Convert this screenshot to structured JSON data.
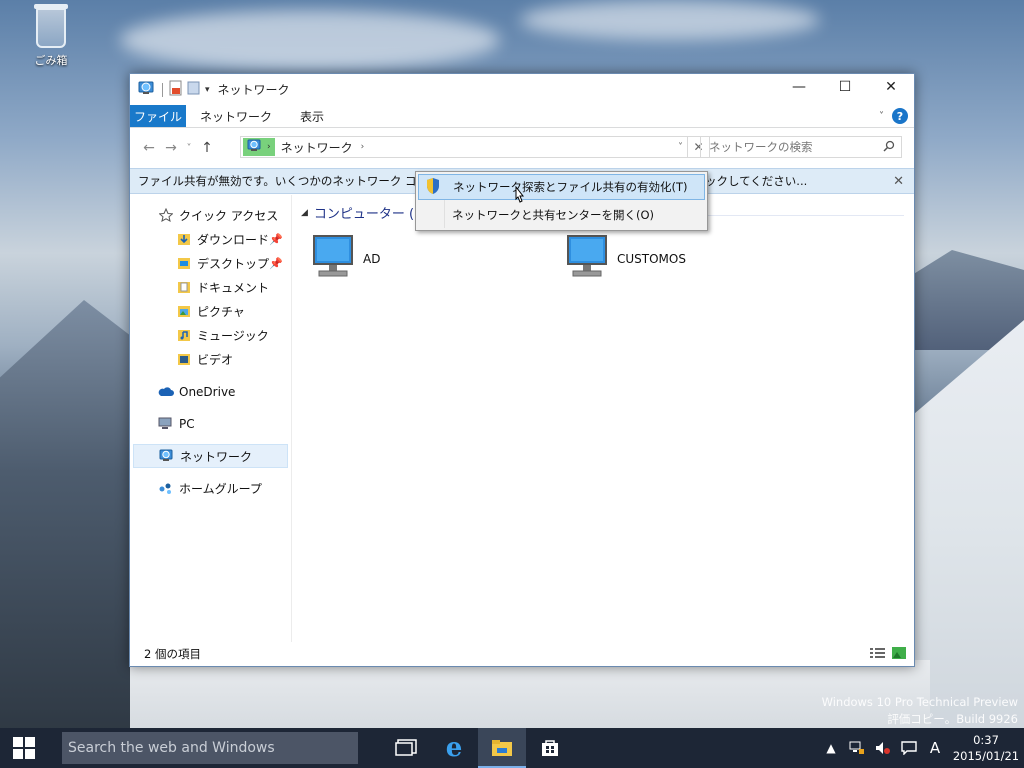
{
  "desktop": {
    "recycle_bin_label": "ごみ箱",
    "watermark_line1": "Windows 10 Pro Technical Preview",
    "watermark_line2": "評価コピー。Build 9926"
  },
  "window": {
    "title": "ネットワーク",
    "controls": {
      "minimize": "—",
      "maximize": "☐",
      "close": "✕"
    }
  },
  "ribbon": {
    "file_tab": "ファイル",
    "tabs": [
      "ネットワーク",
      "表示"
    ],
    "help": "?"
  },
  "navigation": {
    "back": "←",
    "forward": "→",
    "recent": "˅",
    "up": "↑",
    "address_location": "ネットワーク",
    "address_separator": "›",
    "search_placeholder": "ネットワークの検索"
  },
  "infobar": {
    "message_start": "ファイル共有が無効です。いくつかのネットワーク コンピューターとデバイスは表示されません。クリ",
    "message_end": "ックしてください...",
    "close": "✕"
  },
  "context_menu": {
    "items": [
      "ネットワーク探索とファイル共有の有効化(T)",
      "ネットワークと共有センターを開く(O)"
    ]
  },
  "sidebar": {
    "quick_access": "クイック アクセス",
    "quick_items": [
      "ダウンロード",
      "デスクトップ",
      "ドキュメント",
      "ピクチャ",
      "ミュージック",
      "ビデオ"
    ],
    "onedrive": "OneDrive",
    "pc": "PC",
    "network": "ネットワーク",
    "homegroup": "ホームグループ"
  },
  "content": {
    "group_title": "コンピューター (2)",
    "computers": [
      "AD",
      "CUSTOMOS"
    ]
  },
  "status": {
    "item_count": "2 個の項目"
  },
  "taskbar": {
    "search_placeholder": "Search the web and Windows",
    "time": "0:37",
    "date": "2015/01/21",
    "ime": "A"
  },
  "colors": {
    "accent": "#1979ca",
    "selection": "#e5f0fb",
    "infobar": "#ddebf7",
    "taskbar": "#1d2636"
  }
}
